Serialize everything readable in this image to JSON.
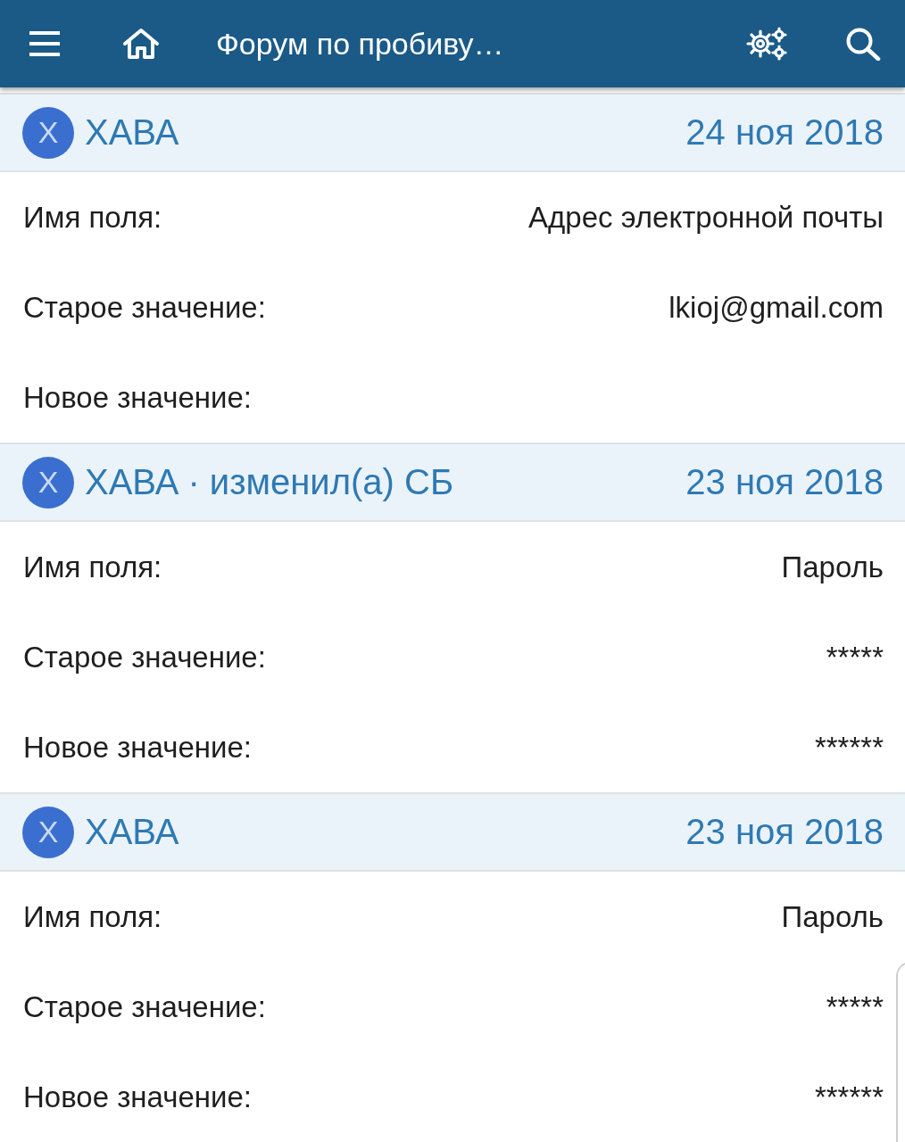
{
  "app_bar": {
    "title": "Форум по пробиву…"
  },
  "entries": [
    {
      "avatar_letter": "Х",
      "author": "ХАВА",
      "date": "24 ноя 2018",
      "fields": [
        {
          "label": "Имя поля:",
          "value": "Адрес электронной почты"
        },
        {
          "label": "Старое значение:",
          "value": "lkioj@gmail.com"
        },
        {
          "label": "Новое значение:"
        }
      ]
    },
    {
      "avatar_letter": "Х",
      "author": "ХАВА",
      "note": "· изменил(а) СБ",
      "date": "23 ноя 2018",
      "fields": [
        {
          "label": "Имя поля:",
          "value": "Пароль"
        },
        {
          "label": "Старое значение:",
          "value": "*****"
        },
        {
          "label": "Новое значение:",
          "value": "******"
        }
      ]
    },
    {
      "avatar_letter": "Х",
      "author": "ХАВА",
      "date": "23 ноя 2018",
      "fields": [
        {
          "label": "Имя поля:",
          "value": "Пароль"
        },
        {
          "label": "Старое значение:",
          "value": "*****"
        },
        {
          "label": "Новое значение:",
          "value": "******"
        }
      ]
    }
  ]
}
